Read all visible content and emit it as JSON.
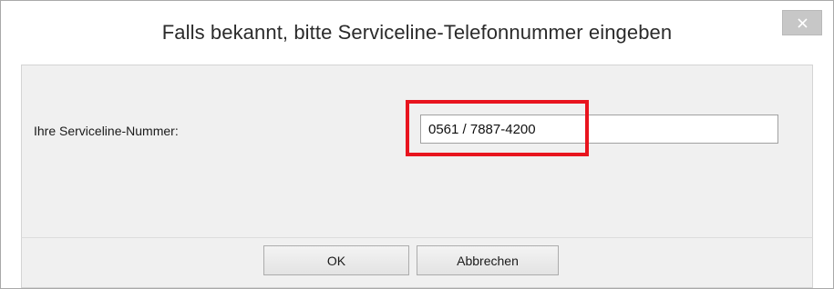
{
  "dialog": {
    "title": "Falls bekannt, bitte Serviceline-Telefonnummer eingeben",
    "close_icon": "close-icon"
  },
  "form": {
    "label": "Ihre Serviceline-Nummer:",
    "phone_value": "0561 / 7887-4200",
    "highlight_color": "#e8141e"
  },
  "buttons": {
    "ok_label": "OK",
    "cancel_label": "Abbrechen"
  }
}
